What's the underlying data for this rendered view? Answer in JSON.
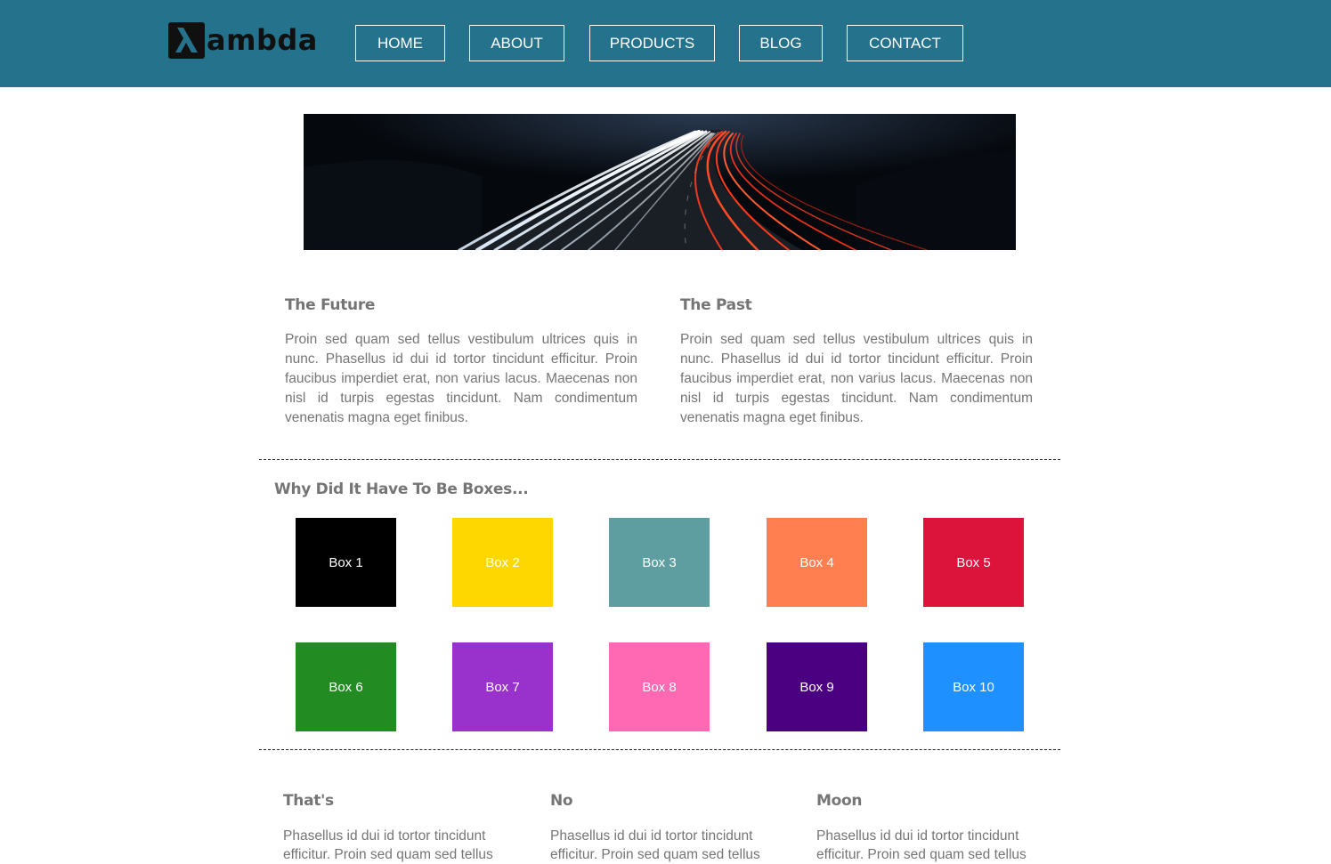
{
  "header": {
    "logo_text": "ambda",
    "nav": [
      "HOME",
      "ABOUT",
      "PRODUCTS",
      "BLOG",
      "CONTACT"
    ]
  },
  "colors": {
    "header_bg": "#24728b",
    "text_gray": "#757575"
  },
  "main": {
    "future": {
      "title": "The Future",
      "text": "Proin sed quam sed tellus vestibulum ultrices quis in nunc. Phasellus id dui id tortor tincidunt efficitur. Proin faucibus imperdiet erat, non varius lacus. Maecenas non nisl id turpis egestas tincidunt. Nam condimentum venenatis magna eget finibus."
    },
    "past": {
      "title": "The Past",
      "text": "Proin sed quam sed tellus vestibulum ultrices quis in nunc. Phasellus id dui id tortor tincidunt efficitur. Proin faucibus imperdiet erat, non varius lacus. Maecenas non nisl id turpis egestas tincidunt. Nam condimentum venenatis magna eget finibus."
    },
    "boxes_title": "Why Did It Have To Be Boxes...",
    "boxes": [
      {
        "label": "Box 1",
        "color": "#000000"
      },
      {
        "label": "Box 2",
        "color": "#ffd700"
      },
      {
        "label": "Box 3",
        "color": "#5f9ea0"
      },
      {
        "label": "Box 4",
        "color": "#ff7f50"
      },
      {
        "label": "Box 5",
        "color": "#dc143c"
      },
      {
        "label": "Box 6",
        "color": "#228b22"
      },
      {
        "label": "Box 7",
        "color": "#9932cc"
      },
      {
        "label": "Box 8",
        "color": "#ff69b4"
      },
      {
        "label": "Box 9",
        "color": "#4b0082"
      },
      {
        "label": "Box 10",
        "color": "#1e90ff"
      }
    ],
    "columns": [
      {
        "title": "That's",
        "text": "Phasellus id dui id tortor tincidunt efficitur. Proin sed quam sed tellus"
      },
      {
        "title": "No",
        "text": "Phasellus id dui id tortor tincidunt efficitur. Proin sed quam sed tellus"
      },
      {
        "title": "Moon",
        "text": "Phasellus id dui id tortor tincidunt efficitur. Proin sed quam sed tellus"
      }
    ]
  }
}
